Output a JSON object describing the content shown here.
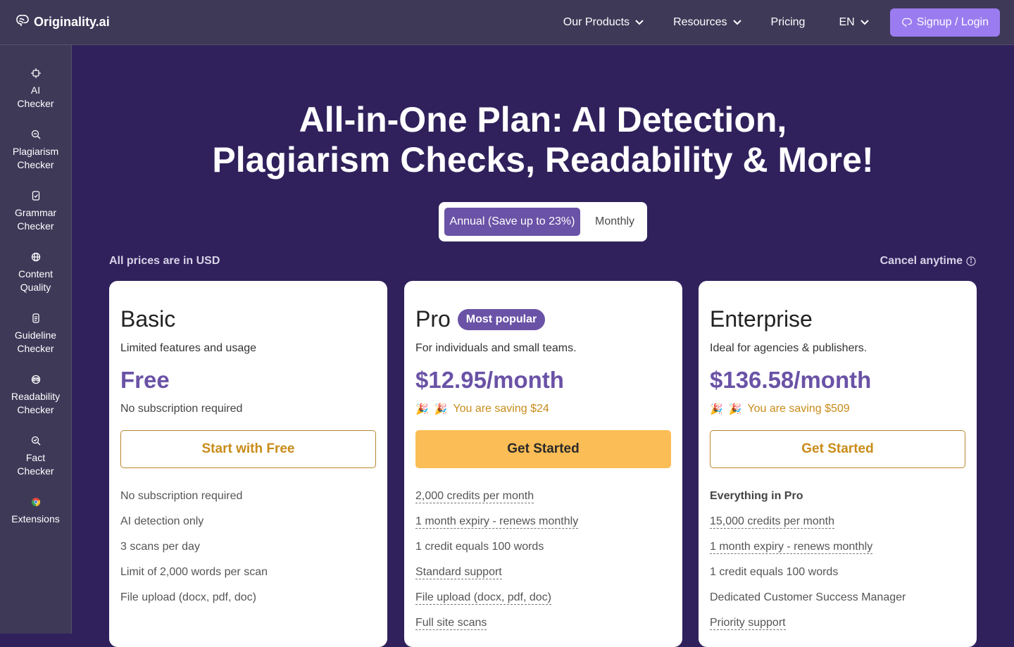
{
  "brand": {
    "name": "Originality.ai"
  },
  "nav": {
    "products": "Our Products",
    "resources": "Resources",
    "pricing": "Pricing",
    "language": "EN",
    "signup": "Signup / Login"
  },
  "sidebar": {
    "items": [
      {
        "label": "AI Checker",
        "icon": "chip-icon"
      },
      {
        "label": "Plagiarism Checker",
        "icon": "search-zoom-icon"
      },
      {
        "label": "Grammar Checker",
        "icon": "grammar-icon"
      },
      {
        "label": "Content Quality",
        "icon": "globe-icon"
      },
      {
        "label": "Guideline Checker",
        "icon": "document-icon"
      },
      {
        "label": "Readability Checker",
        "icon": "readability-icon"
      },
      {
        "label": "Fact Checker",
        "icon": "fact-search-icon"
      },
      {
        "label": "Extensions",
        "icon": "chrome-icon"
      }
    ]
  },
  "hero": {
    "line1": "All-in-One Plan: AI Detection,",
    "line2": "Plagiarism Checks, Readability & More!"
  },
  "billing": {
    "annual": "Annual (Save up to 23%)",
    "monthly": "Monthly",
    "selected": "Annual (Save up to 23%)"
  },
  "notes": {
    "currency": "All prices are in USD",
    "cancel": "Cancel anytime"
  },
  "plans": [
    {
      "name": "Basic",
      "desc": "Limited features and usage",
      "price": "Free",
      "sub": "No subscription required",
      "cta": "Start with Free",
      "features": [
        "No subscription required",
        "AI detection only",
        "3 scans per day",
        "Limit of 2,000 words per scan",
        "File upload (docx, pdf, doc)"
      ]
    },
    {
      "name": "Pro",
      "badge": "Most popular",
      "desc": "For individuals and small teams.",
      "price": "$12.95/month",
      "saving": "You are saving $24",
      "cta": "Get Started",
      "features": [
        "2,000 credits per month",
        "1 month expiry - renews monthly",
        "1 credit equals 100 words",
        "Standard support",
        "File upload (docx, pdf, doc)",
        "Full site scans"
      ]
    },
    {
      "name": "Enterprise",
      "desc": "Ideal for agencies & publishers.",
      "price": "$136.58/month",
      "saving": "You are saving $509",
      "cta": "Get Started",
      "features": [
        "Everything in Pro",
        "15,000 credits per month",
        "1 month expiry - renews monthly",
        "1 credit equals 100 words",
        "Dedicated Customer Success Manager",
        "Priority support"
      ]
    }
  ],
  "colors": {
    "background": "#30215c",
    "nav": "#3f3958",
    "accent": "#6a52a6",
    "signup": "#9b7cf0",
    "cta": "#fbbd55",
    "saving": "#c98c1a"
  }
}
